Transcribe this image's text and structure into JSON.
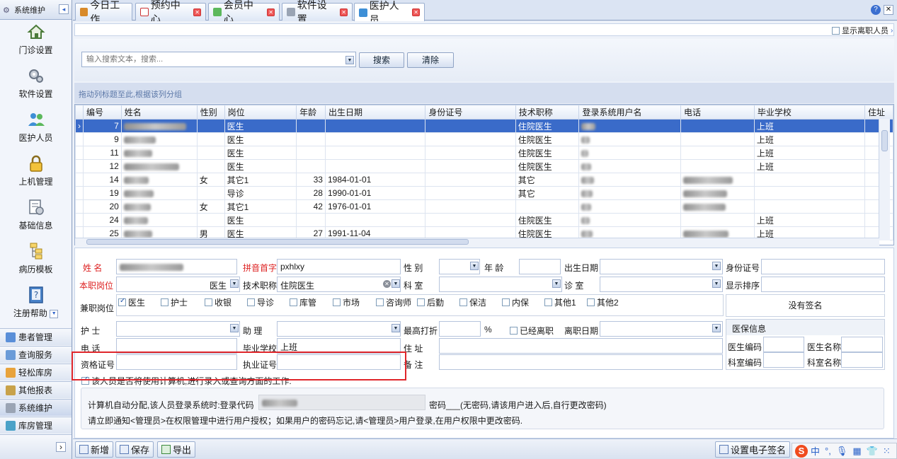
{
  "sidebar": {
    "header": "系统维护",
    "collapse_symbol": "◂",
    "items": [
      {
        "label": "门诊设置",
        "icon": "home-icon"
      },
      {
        "label": "软件设置",
        "icon": "gears-icon"
      },
      {
        "label": "医护人员",
        "icon": "users-icon"
      },
      {
        "label": "上机管理",
        "icon": "lock-icon"
      },
      {
        "label": "基础信息",
        "icon": "settings-doc-icon"
      },
      {
        "label": "病历模板",
        "icon": "tree-icon"
      },
      {
        "label": "注册帮助",
        "icon": "help-book-icon"
      }
    ],
    "bottom_items": [
      {
        "label": "患者管理"
      },
      {
        "label": "查询服务"
      },
      {
        "label": "轻松库房"
      },
      {
        "label": "其他报表"
      },
      {
        "label": "系统维护"
      },
      {
        "label": "库房管理"
      }
    ],
    "more_symbol": "›"
  },
  "tabs": [
    {
      "label": "今日工作"
    },
    {
      "label": "预约中心"
    },
    {
      "label": "会员中心"
    },
    {
      "label": "软件设置"
    },
    {
      "label": "医护人员"
    }
  ],
  "help_symbol": "?",
  "close_symbol": "✕",
  "show_departed_label": "显示离职人员",
  "search": {
    "placeholder": "输入搜索文本，搜索...",
    "search_button": "搜索",
    "clear_button": "清除"
  },
  "group_hint": "拖动列标题至此,根据该列分组",
  "grid": {
    "columns": [
      "编号",
      "姓名",
      "性别",
      "岗位",
      "年龄",
      "出生日期",
      "身份证号",
      "技术职称",
      "登录系统用户名",
      "电话",
      "毕业学校",
      "住址"
    ],
    "rows": [
      {
        "id": "7",
        "gender": "",
        "post": "医生",
        "age": "",
        "birth": "",
        "title": "住院医生",
        "school": "上班"
      },
      {
        "id": "9",
        "gender": "",
        "post": "医生",
        "age": "",
        "birth": "",
        "title": "住院医生",
        "school": "上班"
      },
      {
        "id": "11",
        "gender": "",
        "post": "医生",
        "age": "",
        "birth": "",
        "title": "住院医生",
        "school": "上班"
      },
      {
        "id": "12",
        "gender": "",
        "post": "医生",
        "age": "",
        "birth": "",
        "title": "住院医生",
        "school": "上班"
      },
      {
        "id": "14",
        "gender": "女",
        "post": "其它1",
        "age": "33",
        "birth": "1984-01-01",
        "title": "其它",
        "school": ""
      },
      {
        "id": "19",
        "gender": "",
        "post": "导诊",
        "age": "28",
        "birth": "1990-01-01",
        "title": "其它",
        "school": ""
      },
      {
        "id": "20",
        "gender": "女",
        "post": "其它1",
        "age": "42",
        "birth": "1976-01-01",
        "title": "",
        "school": ""
      },
      {
        "id": "24",
        "gender": "",
        "post": "医生",
        "age": "",
        "birth": "",
        "title": "住院医生",
        "school": "上班"
      },
      {
        "id": "25",
        "gender": "男",
        "post": "医生",
        "age": "27",
        "birth": "1991-11-04",
        "title": "住院医生",
        "school": "上班"
      }
    ]
  },
  "form": {
    "name_label": "姓 名",
    "pinyin_label": "拼音首字",
    "pinyin_value": "pxhlxy",
    "gender_label": "性 别",
    "age_label": "年 龄",
    "birth_label": "出生日期",
    "idcard_label": "身份证号",
    "post_label": "本职岗位",
    "post_value": "医生",
    "title_label": "技术职称",
    "title_value": "住院医生",
    "dept_label": "科 室",
    "room_label": "诊 室",
    "order_label": "显示排序",
    "roles_label": "兼职岗位",
    "roles": [
      {
        "label": "医生",
        "checked": true
      },
      {
        "label": "护士",
        "checked": false
      },
      {
        "label": "收银",
        "checked": false
      },
      {
        "label": "导诊",
        "checked": false
      },
      {
        "label": "库管",
        "checked": false
      },
      {
        "label": "市场",
        "checked": false
      },
      {
        "label": "咨询师",
        "checked": false
      },
      {
        "label": "后勤",
        "checked": false
      },
      {
        "label": "保洁",
        "checked": false
      },
      {
        "label": "内保",
        "checked": false
      },
      {
        "label": "其他1",
        "checked": false
      },
      {
        "label": "其他2",
        "checked": false
      }
    ],
    "no_signature": "没有签名",
    "nurse_label": "护 士",
    "assistant_label": "助 理",
    "max_discount_label": "最高打折",
    "percent": "%",
    "departed_label": "已经离职",
    "depart_date_label": "离职日期",
    "insurance_title": "医保信息",
    "phone_label": "电 话",
    "school_label": "毕业学校",
    "school_value": "上班",
    "address_label": "住 址",
    "doc_code_label": "医生编码",
    "doc_name_label": "医生名称",
    "cert_label": "资格证号",
    "license_label": "执业证号",
    "remark_label": "备 注",
    "dept_code_label": "科室编码",
    "dept_name_label": "科室名称",
    "use_computer_label": "该人员是否将使用计算机,进行录入或查询方面的工作:",
    "info_line1_prefix": "计算机自动分配,该人员登录系统时:登录代码",
    "info_line1_password": "密码___(无密码,请该用户进入后,自行更改密码)",
    "info_line2": "请立即通知<管理员>在权限管理中进行用户授权；如果用户的密码忘记,请<管理员>用户登录,在用户权限中更改密码."
  },
  "toolbar": {
    "add": "新增",
    "save": "保存",
    "export": "导出",
    "set_signature": "设置电子签名"
  },
  "ime": {
    "logo": "S",
    "lang": "中",
    "punct": "°,",
    "mic": "🎙",
    "kbd": "▦",
    "shirt": "👕",
    "grid": "⁙"
  },
  "colors": {
    "selection": "#3a6bc9",
    "required_label": "#d22222",
    "highlight_box": "#e0262b"
  }
}
